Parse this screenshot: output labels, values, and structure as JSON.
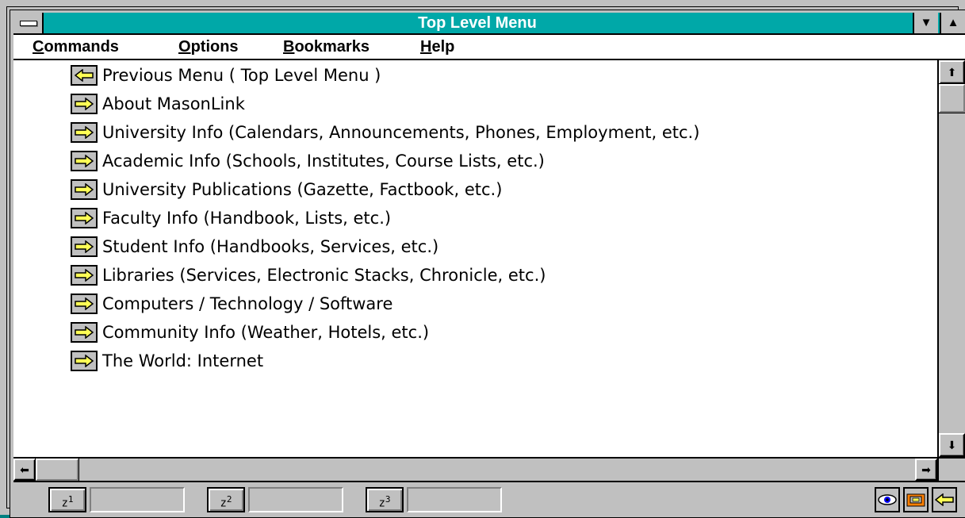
{
  "window": {
    "title": "Top Level Menu",
    "minimize_glyph": "▼",
    "maximize_glyph": "▲"
  },
  "menubar": {
    "items": [
      {
        "label": "Commands",
        "mnemonic": "C"
      },
      {
        "label": "Options",
        "mnemonic": "O"
      },
      {
        "label": "Bookmarks",
        "mnemonic": "B"
      },
      {
        "label": "Help",
        "mnemonic": "H"
      }
    ]
  },
  "menu_list": {
    "items": [
      {
        "label": "Previous Menu ( Top Level Menu )",
        "icon": "left-arrow-icon"
      },
      {
        "label": "About MasonLink",
        "icon": "right-arrow-icon"
      },
      {
        "label": "University Info (Calendars, Announcements, Phones, Employment, etc.)",
        "icon": "right-arrow-icon"
      },
      {
        "label": "Academic Info (Schools, Institutes, Course Lists, etc.)",
        "icon": "right-arrow-icon"
      },
      {
        "label": "University Publications (Gazette, Factbook, etc.)",
        "icon": "right-arrow-icon"
      },
      {
        "label": "Faculty Info (Handbook, Lists, etc.)",
        "icon": "right-arrow-icon"
      },
      {
        "label": "Student Info (Handbooks, Services, etc.)",
        "icon": "right-arrow-icon"
      },
      {
        "label": "Libraries (Services, Electronic Stacks, Chronicle, etc.)",
        "icon": "right-arrow-icon"
      },
      {
        "label": "Computers / Technology / Software",
        "icon": "right-arrow-icon"
      },
      {
        "label": "Community Info (Weather, Hotels, etc.)",
        "icon": "right-arrow-icon"
      },
      {
        "label": "The World: Internet",
        "icon": "right-arrow-icon"
      }
    ]
  },
  "scrollbars": {
    "up_glyph": "⬆",
    "down_glyph": "⬇",
    "left_glyph": "⬅",
    "right_glyph": "➡"
  },
  "toolbar": {
    "buttons": [
      {
        "label": "z",
        "number": "1"
      },
      {
        "label": "z",
        "number": "2"
      },
      {
        "label": "z",
        "number": "3"
      }
    ],
    "status_icons": [
      "eye-icon",
      "folder-icon",
      "back-arrow-icon"
    ]
  },
  "colors": {
    "title_bar": "#00a8a8",
    "arrow_fill": "#ffff55",
    "chrome": "#c0c0c0"
  }
}
